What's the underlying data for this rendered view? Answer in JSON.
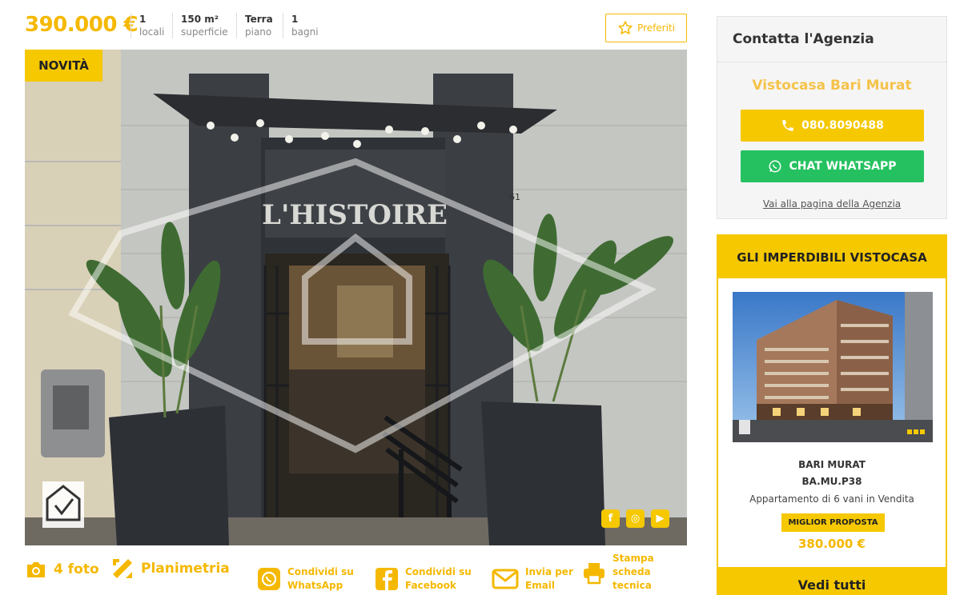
{
  "listing": {
    "price": "390.000 €",
    "stats": [
      {
        "value": "1",
        "label": "locali"
      },
      {
        "value": "150 m²",
        "label": "superficie"
      },
      {
        "value": "Terra",
        "label": "piano"
      },
      {
        "value": "1",
        "label": "bagni"
      }
    ],
    "favorite_label": "Preferiti",
    "badge": "NOVITÀ",
    "sign_text": "L'HISTOIRE",
    "door_number": "61"
  },
  "actions": {
    "photos": "4 foto",
    "floorplan": "Planimetria",
    "share_whatsapp": "Condividi su WhatsApp",
    "share_facebook": "Condividi su Facebook",
    "send_email": "Invia per Email",
    "print_sheet": "Stampa scheda tecnica"
  },
  "contact": {
    "title": "Contatta l'Agenzia",
    "agency_name": "Vistocasa Bari Murat",
    "phone": "080.8090488",
    "whatsapp_label": "CHAT WHATSAPP",
    "agency_link": "Vai alla pagina della Agenzia"
  },
  "promo": {
    "title": "GLI IMPERDIBILI VISTOCASA",
    "zone": "BARI MURAT",
    "ref": "BA.MU.P38",
    "description": "Appartamento di 6 vani in Vendita",
    "tag": "MIGLIOR PROPOSTA",
    "price": "380.000 €",
    "view_all": "Vedi tutti"
  },
  "colors": {
    "brand_yellow": "#f5c800",
    "price_yellow": "#f5b800",
    "whatsapp_green": "#25c160"
  },
  "icons": [
    "star-icon",
    "phone-icon",
    "whatsapp-icon",
    "camera-icon",
    "ruler-pencil-icon",
    "facebook-icon",
    "envelope-icon",
    "printer-icon",
    "instagram-icon",
    "youtube-icon"
  ]
}
